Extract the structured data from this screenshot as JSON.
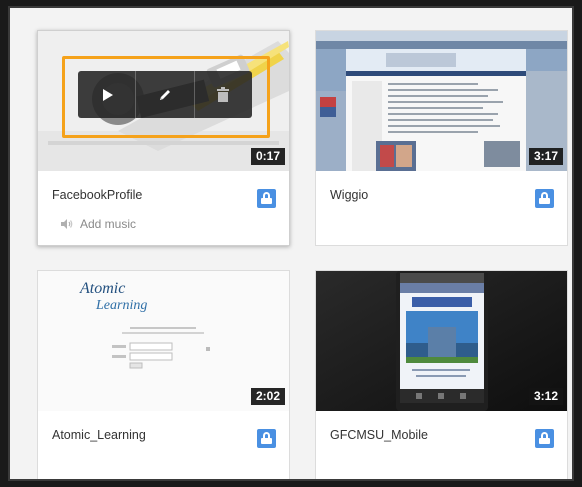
{
  "videos": [
    {
      "title": "FacebookProfile",
      "duration": "0:17",
      "action_label": "Add music"
    },
    {
      "title": "Wiggio",
      "duration": "3:17"
    },
    {
      "title": "Atomic_Learning",
      "duration": "2:02",
      "thumbnail_logo_line1": "Atomic",
      "thumbnail_logo_line2": "Learning"
    },
    {
      "title": "GFCMSU_Mobile",
      "duration": "3:12"
    }
  ],
  "overlay": {
    "buttons": [
      "play-icon",
      "pencil-icon",
      "trash-icon"
    ],
    "highlight_color": "#f5a21b"
  },
  "colors": {
    "lock_badge": "#4a90e2",
    "duration_bg": "#1a1a1a"
  }
}
